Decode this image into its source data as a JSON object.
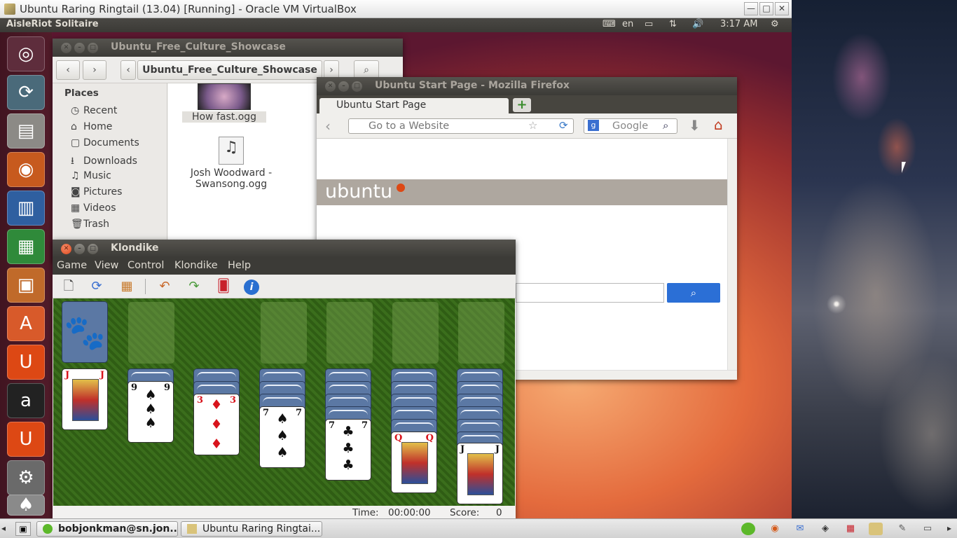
{
  "vbox": {
    "title": "Ubuntu Raring Ringtail (13.04) [Running] - Oracle VM VirtualBox",
    "min_label": "—",
    "max_label": "□",
    "close_label": "✕"
  },
  "panel": {
    "app_name": "AisleRiot Solitaire",
    "keyboard_label": "en",
    "time": "3:17 AM"
  },
  "nautilus": {
    "title": "Ubuntu_Free_Culture_Showcase",
    "breadcrumb": "Ubuntu_Free_Culture_Showcase",
    "places_heading": "Places",
    "places": [
      {
        "icon": "◷",
        "label": "Recent"
      },
      {
        "icon": "⌂",
        "label": "Home"
      },
      {
        "icon": "▢",
        "label": "Documents"
      },
      {
        "icon": "⭳",
        "label": "Downloads"
      },
      {
        "icon": "♫",
        "label": "Music"
      },
      {
        "icon": "◙",
        "label": "Pictures"
      },
      {
        "icon": "▦",
        "label": "Videos"
      },
      {
        "icon": "🗑",
        "label": "Trash"
      }
    ],
    "files": [
      {
        "label": "How fast.ogg"
      },
      {
        "label": "Josh Woodward -",
        "label2": "Swansong.ogg"
      }
    ]
  },
  "firefox": {
    "title": "Ubuntu Start Page - Mozilla Firefox",
    "tab_label": "Ubuntu Start Page",
    "new_tab": "+",
    "url_placeholder": "Go to a Website",
    "search_placeholder": "Google",
    "ubuntu_logo": "ubuntu"
  },
  "klondike": {
    "title": "Klondike",
    "menus": [
      "Game",
      "View",
      "Control",
      "Klondike",
      "Help"
    ],
    "time_label": "Time:",
    "time_value": "00:00:00",
    "score_label": "Score:",
    "score_value": "0",
    "tableau": [
      {
        "rank": "J",
        "suit": "♥",
        "color": "red"
      },
      {
        "rank": "9",
        "suit": "♠",
        "color": "black"
      },
      {
        "rank": "3",
        "suit": "♦",
        "color": "red"
      },
      {
        "rank": "7",
        "suit": "♠",
        "color": "black"
      },
      {
        "rank": "7",
        "suit": "♣",
        "color": "black"
      },
      {
        "rank": "Q",
        "suit": "♦",
        "color": "red"
      },
      {
        "rank": "J",
        "suit": "♣",
        "color": "black"
      }
    ]
  },
  "taskbar": {
    "task1": "bobjonkman@sn.jon...",
    "task2": "Ubuntu Raring Ringtai..."
  },
  "colors": {
    "ubuntu_orange": "#dd4814",
    "felt_green": "#3b6e1c",
    "card_back": "#5b78a4"
  }
}
